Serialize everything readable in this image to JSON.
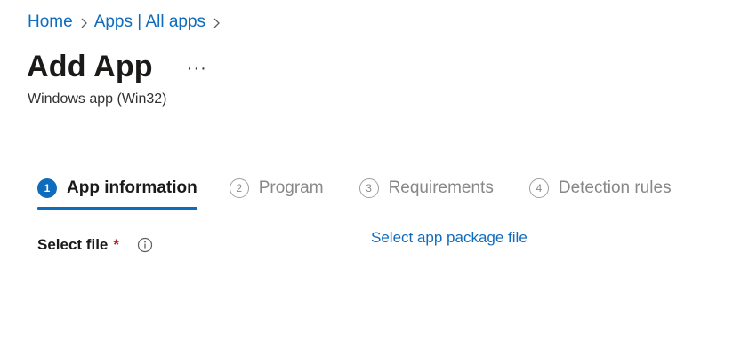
{
  "breadcrumb": {
    "items": [
      "Home",
      "Apps | All apps"
    ]
  },
  "header": {
    "title": "Add App",
    "more_label": "···",
    "subtitle": "Windows app (Win32)"
  },
  "wizard": {
    "steps": [
      {
        "number": "1",
        "label": "App information",
        "state": "active"
      },
      {
        "number": "2",
        "label": "Program",
        "state": "inactive"
      },
      {
        "number": "3",
        "label": "Requirements",
        "state": "inactive"
      },
      {
        "number": "4",
        "label": "Detection rules",
        "state": "inactive"
      }
    ]
  },
  "form": {
    "select_file_label": "Select file",
    "required_marker": "*",
    "select_file_link": "Select app package file"
  },
  "colors": {
    "accent": "#0f6cbd",
    "required": "#a4262c",
    "text": "#323130",
    "muted": "#8a8886"
  }
}
